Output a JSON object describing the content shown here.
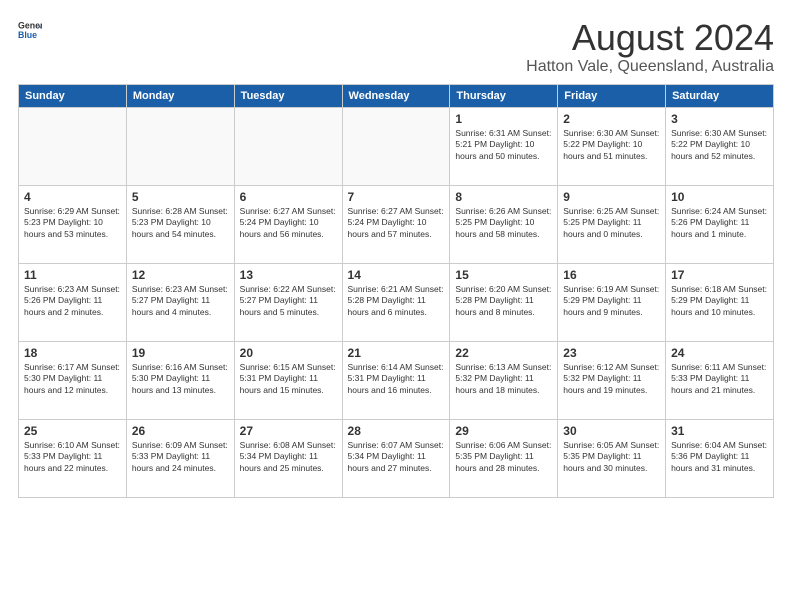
{
  "logo": {
    "general": "General",
    "blue": "Blue"
  },
  "title": "August 2024",
  "subtitle": "Hatton Vale, Queensland, Australia",
  "days_of_week": [
    "Sunday",
    "Monday",
    "Tuesday",
    "Wednesday",
    "Thursday",
    "Friday",
    "Saturday"
  ],
  "weeks": [
    [
      {
        "day": "",
        "info": ""
      },
      {
        "day": "",
        "info": ""
      },
      {
        "day": "",
        "info": ""
      },
      {
        "day": "",
        "info": ""
      },
      {
        "day": "1",
        "info": "Sunrise: 6:31 AM\nSunset: 5:21 PM\nDaylight: 10 hours\nand 50 minutes."
      },
      {
        "day": "2",
        "info": "Sunrise: 6:30 AM\nSunset: 5:22 PM\nDaylight: 10 hours\nand 51 minutes."
      },
      {
        "day": "3",
        "info": "Sunrise: 6:30 AM\nSunset: 5:22 PM\nDaylight: 10 hours\nand 52 minutes."
      }
    ],
    [
      {
        "day": "4",
        "info": "Sunrise: 6:29 AM\nSunset: 5:23 PM\nDaylight: 10 hours\nand 53 minutes."
      },
      {
        "day": "5",
        "info": "Sunrise: 6:28 AM\nSunset: 5:23 PM\nDaylight: 10 hours\nand 54 minutes."
      },
      {
        "day": "6",
        "info": "Sunrise: 6:27 AM\nSunset: 5:24 PM\nDaylight: 10 hours\nand 56 minutes."
      },
      {
        "day": "7",
        "info": "Sunrise: 6:27 AM\nSunset: 5:24 PM\nDaylight: 10 hours\nand 57 minutes."
      },
      {
        "day": "8",
        "info": "Sunrise: 6:26 AM\nSunset: 5:25 PM\nDaylight: 10 hours\nand 58 minutes."
      },
      {
        "day": "9",
        "info": "Sunrise: 6:25 AM\nSunset: 5:25 PM\nDaylight: 11 hours\nand 0 minutes."
      },
      {
        "day": "10",
        "info": "Sunrise: 6:24 AM\nSunset: 5:26 PM\nDaylight: 11 hours\nand 1 minute."
      }
    ],
    [
      {
        "day": "11",
        "info": "Sunrise: 6:23 AM\nSunset: 5:26 PM\nDaylight: 11 hours\nand 2 minutes."
      },
      {
        "day": "12",
        "info": "Sunrise: 6:23 AM\nSunset: 5:27 PM\nDaylight: 11 hours\nand 4 minutes."
      },
      {
        "day": "13",
        "info": "Sunrise: 6:22 AM\nSunset: 5:27 PM\nDaylight: 11 hours\nand 5 minutes."
      },
      {
        "day": "14",
        "info": "Sunrise: 6:21 AM\nSunset: 5:28 PM\nDaylight: 11 hours\nand 6 minutes."
      },
      {
        "day": "15",
        "info": "Sunrise: 6:20 AM\nSunset: 5:28 PM\nDaylight: 11 hours\nand 8 minutes."
      },
      {
        "day": "16",
        "info": "Sunrise: 6:19 AM\nSunset: 5:29 PM\nDaylight: 11 hours\nand 9 minutes."
      },
      {
        "day": "17",
        "info": "Sunrise: 6:18 AM\nSunset: 5:29 PM\nDaylight: 11 hours\nand 10 minutes."
      }
    ],
    [
      {
        "day": "18",
        "info": "Sunrise: 6:17 AM\nSunset: 5:30 PM\nDaylight: 11 hours\nand 12 minutes."
      },
      {
        "day": "19",
        "info": "Sunrise: 6:16 AM\nSunset: 5:30 PM\nDaylight: 11 hours\nand 13 minutes."
      },
      {
        "day": "20",
        "info": "Sunrise: 6:15 AM\nSunset: 5:31 PM\nDaylight: 11 hours\nand 15 minutes."
      },
      {
        "day": "21",
        "info": "Sunrise: 6:14 AM\nSunset: 5:31 PM\nDaylight: 11 hours\nand 16 minutes."
      },
      {
        "day": "22",
        "info": "Sunrise: 6:13 AM\nSunset: 5:32 PM\nDaylight: 11 hours\nand 18 minutes."
      },
      {
        "day": "23",
        "info": "Sunrise: 6:12 AM\nSunset: 5:32 PM\nDaylight: 11 hours\nand 19 minutes."
      },
      {
        "day": "24",
        "info": "Sunrise: 6:11 AM\nSunset: 5:33 PM\nDaylight: 11 hours\nand 21 minutes."
      }
    ],
    [
      {
        "day": "25",
        "info": "Sunrise: 6:10 AM\nSunset: 5:33 PM\nDaylight: 11 hours\nand 22 minutes."
      },
      {
        "day": "26",
        "info": "Sunrise: 6:09 AM\nSunset: 5:33 PM\nDaylight: 11 hours\nand 24 minutes."
      },
      {
        "day": "27",
        "info": "Sunrise: 6:08 AM\nSunset: 5:34 PM\nDaylight: 11 hours\nand 25 minutes."
      },
      {
        "day": "28",
        "info": "Sunrise: 6:07 AM\nSunset: 5:34 PM\nDaylight: 11 hours\nand 27 minutes."
      },
      {
        "day": "29",
        "info": "Sunrise: 6:06 AM\nSunset: 5:35 PM\nDaylight: 11 hours\nand 28 minutes."
      },
      {
        "day": "30",
        "info": "Sunrise: 6:05 AM\nSunset: 5:35 PM\nDaylight: 11 hours\nand 30 minutes."
      },
      {
        "day": "31",
        "info": "Sunrise: 6:04 AM\nSunset: 5:36 PM\nDaylight: 11 hours\nand 31 minutes."
      }
    ]
  ]
}
